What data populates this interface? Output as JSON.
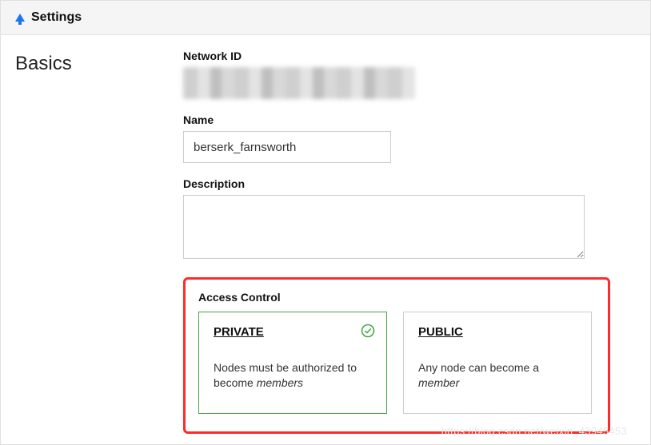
{
  "header": {
    "title": "Settings"
  },
  "section": {
    "label": "Basics"
  },
  "network_id": {
    "label": "Network ID"
  },
  "name": {
    "label": "Name",
    "value": "berserk_farnsworth"
  },
  "description": {
    "label": "Description",
    "value": ""
  },
  "access": {
    "label": "Access Control",
    "private": {
      "title": "PRIVATE",
      "desc_pre": "Nodes must be authorized to become ",
      "desc_em": "members",
      "selected": true
    },
    "public": {
      "title": "PUBLIC",
      "desc_pre": "Any node can become a ",
      "desc_em": "member",
      "selected": false
    }
  },
  "watermark": "https://blog.csdn.net/weixin_43945453"
}
